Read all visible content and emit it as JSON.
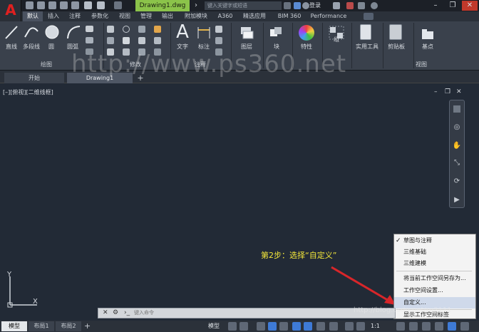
{
  "app": {
    "document_tab": "Drawing1.dwg",
    "search_placeholder": "键入关键字或短语",
    "login_label": "登录"
  },
  "ribbon": {
    "tabs": [
      "默认",
      "插入",
      "注释",
      "参数化",
      "视图",
      "管理",
      "输出",
      "附加模块",
      "A360",
      "精选应用",
      "BIM 360",
      "Performance"
    ],
    "draw_tools": [
      "直线",
      "多段线",
      "圆",
      "圆弧"
    ],
    "big_tools": [
      "文字",
      "标注",
      "图层",
      "块",
      "特性",
      "组",
      "实用工具",
      "剪贴板",
      "基点"
    ],
    "groups": [
      "绘图",
      "修改",
      "注释",
      "视图"
    ]
  },
  "doc_tabs": [
    "开始",
    "Drawing1"
  ],
  "canvas": {
    "view_label": "[–][俯视][二维线框]",
    "axis_y": "Y",
    "axis_x": "X",
    "watermark": "http://www.ps360.net"
  },
  "workspace_menu": {
    "items": [
      "草图与注释",
      "三维基础",
      "三维建模",
      "将当前工作空间另存为...",
      "工作空间设置...",
      "自定义...",
      "显示工作空间标签"
    ],
    "checked_index": 0,
    "highlighted_index": 5
  },
  "annotation": {
    "step_text": "第2步：选择“自定义”",
    "color": "#f2e63a"
  },
  "command_line": {
    "placeholder": "键入命令"
  },
  "layout_tabs": [
    "模型",
    "布局1",
    "布局2"
  ],
  "status": {
    "model_label": "模型",
    "scale_label": "1:1"
  },
  "footer_credit": "http://blog.csdn.net/ru2111",
  "colors": {
    "canvas_bg": "#222a36",
    "active_doc_tab": "#8bc34a",
    "logo_red": "#e02020"
  }
}
